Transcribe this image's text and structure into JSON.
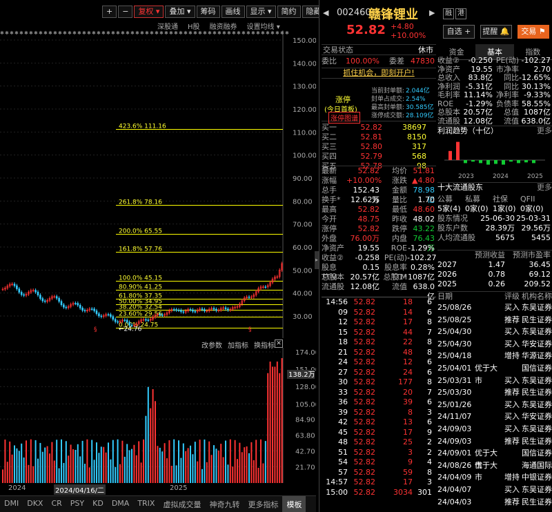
{
  "toolbar": [
    "复权",
    "叠加",
    "筹码",
    "画线",
    "显示",
    "简约",
    "隐藏"
  ],
  "subbar": [
    "深股通",
    "H股",
    "融资融券",
    "设置均线"
  ],
  "price_axis": [
    "150.00",
    "140.00",
    "130.00",
    "120.00",
    "110.00",
    "100.00",
    "90.00",
    "80.00",
    "70.00",
    "60.00",
    "50.00",
    "40.00",
    "30.00"
  ],
  "vol_axis": [
    "174.00",
    "151.00",
    "128.00",
    "105.00",
    "84.90",
    "63.80",
    "42.70",
    "21.70"
  ],
  "vol_current": "138.2万",
  "fib_lines": [
    {
      "label": "423.6%",
      "value": "111.16"
    },
    {
      "label": "261.8%",
      "value": "78.16"
    },
    {
      "label": "200.0%",
      "value": "65.55"
    },
    {
      "label": "161.8%",
      "value": "57.76"
    },
    {
      "label": "100.0%",
      "value": "45.15"
    },
    {
      "label": "80.90%",
      "value": "41.25"
    },
    {
      "label": "61.80%",
      "value": "37.35"
    },
    {
      "label": "50.00%",
      "value": "34.95"
    },
    {
      "label": "38.20%",
      "value": "32.54"
    },
    {
      "label": "23.60%",
      "value": "29.56"
    },
    {
      "label": "0.00%",
      "value": "24.75"
    }
  ],
  "price_low_label": "24.76",
  "ind_bar": [
    "改参数",
    "加指标",
    "换指标"
  ],
  "date_labels": [
    "2024",
    "2024/04/16/二",
    "2025"
  ],
  "bottom_tabs": [
    "DMI",
    "DKX",
    "CR",
    "PSY",
    "KD",
    "DMA",
    "TRIX",
    "虚拟成交量",
    "神奇九转",
    "更多指标",
    "模板"
  ],
  "stock": {
    "code": "002460",
    "name": "赣锋锂业",
    "price": "52.82",
    "change": "+4.80",
    "pct": "+10.00%",
    "tag1": "融",
    "tag2": "港"
  },
  "buttons": {
    "watch": "自选 +",
    "alert": "提醒",
    "trade": "交易"
  },
  "status": {
    "label": "交易状态",
    "value": "休市"
  },
  "weibi": {
    "label": "委比",
    "value": "100.00%",
    "label2": "委差",
    "value2": "47830"
  },
  "ad": "抓住机会，即刻开户!",
  "limit": {
    "title": "涨停",
    "sub": "(今日首板)",
    "btn": "涨停图谱",
    "items": [
      {
        "k": "当前封单额:",
        "v": "2.044亿"
      },
      {
        "k": "封单占成交:",
        "v": "2.54%"
      },
      {
        "k": "最高封单额:",
        "v": "30.585亿"
      },
      {
        "k": "涨停成交额:",
        "v": "28.109亿"
      }
    ]
  },
  "bids": [
    {
      "k": "买一",
      "p": "52.82",
      "v": "38697"
    },
    {
      "k": "买二",
      "p": "52.81",
      "v": "8150"
    },
    {
      "k": "买三",
      "p": "52.80",
      "v": "317"
    },
    {
      "k": "买四",
      "p": "52.79",
      "v": "568"
    },
    {
      "k": "买五",
      "p": "52.78",
      "v": "98"
    }
  ],
  "stats": [
    [
      "最新",
      "52.82",
      "均价",
      "51.81"
    ],
    [
      "涨幅",
      "+10.00%",
      "涨跌",
      "▲4.80"
    ],
    [
      "总手",
      "152.43万",
      "金额",
      "78.98亿"
    ],
    [
      "换手*",
      "12.62%",
      "量比",
      "1.70"
    ],
    [
      "最高",
      "52.82",
      "最低",
      "48.60"
    ],
    [
      "今开",
      "48.75",
      "昨收",
      "48.02"
    ],
    [
      "涨停",
      "52.82",
      "跌停",
      "43.22"
    ],
    [
      "外盘",
      "76.00万",
      "内盘",
      "76.43万"
    ],
    [
      "净资产",
      "19.55",
      "ROE",
      "-1.29%"
    ],
    [
      "收益②",
      "-0.258",
      "PE(动)",
      "-102.27"
    ],
    [
      "股息TTM",
      "0.15",
      "股息率TTM",
      "0.28%"
    ],
    [
      "总股本",
      "20.57亿",
      "总股1*",
      "1087亿"
    ],
    [
      "流通股",
      "12.08亿",
      "流值",
      "638.0亿"
    ]
  ],
  "ticks": [
    [
      "14:56",
      "52.82",
      "18",
      "6"
    ],
    [
      "09",
      "52.82",
      "14",
      "6"
    ],
    [
      "12",
      "52.82",
      "17",
      "8"
    ],
    [
      "15",
      "52.82",
      "44",
      "7"
    ],
    [
      "18",
      "52.82",
      "22",
      "8"
    ],
    [
      "21",
      "52.82",
      "48",
      "8"
    ],
    [
      "24",
      "52.82",
      "12",
      "6"
    ],
    [
      "27",
      "52.82",
      "24",
      "6"
    ],
    [
      "30",
      "52.82",
      "177",
      "8"
    ],
    [
      "33",
      "52.82",
      "20",
      "7"
    ],
    [
      "36",
      "52.82",
      "39",
      "6"
    ],
    [
      "39",
      "52.82",
      "8",
      "3"
    ],
    [
      "42",
      "52.82",
      "13",
      "6"
    ],
    [
      "45",
      "52.82",
      "17",
      "9"
    ],
    [
      "48",
      "52.82",
      "25",
      "2"
    ],
    [
      "51",
      "52.82",
      "3",
      "2"
    ],
    [
      "54",
      "52.82",
      "9",
      "4"
    ],
    [
      "57",
      "52.82",
      "59",
      "8"
    ],
    [
      "14:57",
      "52.82",
      "17",
      "3"
    ],
    [
      "15:00",
      "52.82",
      "3034",
      "301"
    ]
  ],
  "ftabs": [
    "资金",
    "基本",
    "指数"
  ],
  "fund": [
    [
      "收益②",
      "-0.250",
      "PE(动)",
      "-102.27"
    ],
    [
      "净资产",
      "19.55",
      "市净率",
      "2.70"
    ],
    [
      "总收入",
      "83.8亿",
      "同比",
      "-12.65%"
    ],
    [
      "净利润",
      "-5.31亿",
      "同比",
      "30.13%"
    ],
    [
      "毛利率",
      "11.14%",
      "净利率",
      "-9.33%"
    ],
    [
      "ROE",
      "-1.29%",
      "负债率",
      "58.55%"
    ],
    [
      "总股本",
      "20.57亿",
      "总值",
      "1087亿"
    ],
    [
      "流通股",
      "12.08亿",
      "流值",
      "638.0亿"
    ]
  ],
  "profit": {
    "title": "利润趋势（十亿）",
    "more": "更多",
    "years": [
      "2023",
      "2024",
      "2025"
    ],
    "values": [
      0.6,
      1.2,
      -0.2,
      -0.1,
      -0.2,
      -0.3,
      -0.25,
      -0.3,
      -0.1,
      -0.2,
      -0.15,
      -0.2
    ]
  },
  "holders": {
    "title": "十大流通股东",
    "more": "更多",
    "cols": [
      "公募",
      "私募",
      "社保",
      "QFII"
    ],
    "counts": [
      "5家(4)",
      "0家(0)",
      "1家(0)",
      "0家(0)"
    ],
    "rows": [
      [
        "股东情况",
        "25-06-30",
        "25-03-31"
      ],
      [
        "股东户数",
        "28.39万",
        "29.56万"
      ],
      [
        "人均流通股",
        "5675",
        "5455"
      ]
    ]
  },
  "forecast": {
    "cols": [
      "",
      "预测收益",
      "预测市盈率"
    ],
    "rows": [
      [
        "2027",
        "1.47",
        "36.45"
      ],
      [
        "2026",
        "0.78",
        "69.12"
      ],
      [
        "2025",
        "0.26",
        "209.52"
      ]
    ]
  },
  "ratings": {
    "cols": [
      "日期",
      "",
      "评级",
      "机构名称"
    ],
    "rows": [
      [
        "25/08/26",
        "",
        "买入",
        "东吴证券"
      ],
      [
        "25/08/25",
        "",
        "推荐",
        "民生证券"
      ],
      [
        "25/04/30",
        "",
        "买入",
        "东吴证券"
      ],
      [
        "25/04/30",
        "",
        "买入",
        "华安证券"
      ],
      [
        "25/04/18",
        "",
        "增持",
        "华源证券"
      ],
      [
        "25/04/01",
        "优于大市",
        "",
        "国信证券"
      ],
      [
        "25/03/31",
        "",
        "买入",
        "东吴证券"
      ],
      [
        "25/03/30",
        "",
        "推荐",
        "民生证券"
      ],
      [
        "25/01/26",
        "",
        "买入",
        "东吴证券"
      ],
      [
        "24/11/07",
        "",
        "买入",
        "华安证券"
      ],
      [
        "24/09/03",
        "",
        "买入",
        "东吴证券"
      ],
      [
        "24/09/03",
        "",
        "推荐",
        "民生证券"
      ],
      [
        "24/09/01",
        "优于大市",
        "",
        "国信证券"
      ],
      [
        "24/08/26",
        "优于大市",
        "",
        "海通国际"
      ],
      [
        "24/04/09",
        "",
        "增持",
        "中银证券"
      ],
      [
        "24/04/07",
        "",
        "买入",
        "东吴证券"
      ],
      [
        "24/04/03",
        "",
        "推荐",
        "民生证券"
      ]
    ]
  }
}
